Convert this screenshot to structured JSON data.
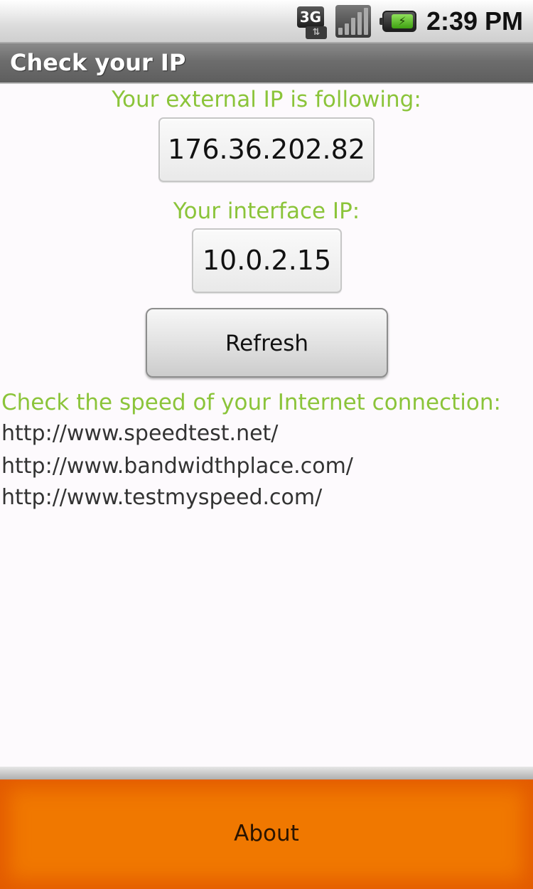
{
  "status_bar": {
    "network_label": "3G",
    "network_arrows": "⇅",
    "time": "2:39 PM"
  },
  "title_bar": {
    "title": "Check your IP"
  },
  "external_ip": {
    "label": "Your external IP is following:",
    "value": "176.36.202.82"
  },
  "interface_ip": {
    "label": "Your interface IP:",
    "value": "10.0.2.15"
  },
  "refresh_button": {
    "label": "Refresh"
  },
  "speed": {
    "label": "Check the speed of your Internet connection:",
    "links": [
      "http://www.speedtest.net/",
      "http://www.bandwidthplace.com/",
      "http://www.testmyspeed.com/"
    ]
  },
  "about_button": {
    "label": "About"
  },
  "colors": {
    "accent_green": "#8bc43a",
    "about_orange": "#f07800",
    "title_bar_gray": "#6d6d6d"
  }
}
